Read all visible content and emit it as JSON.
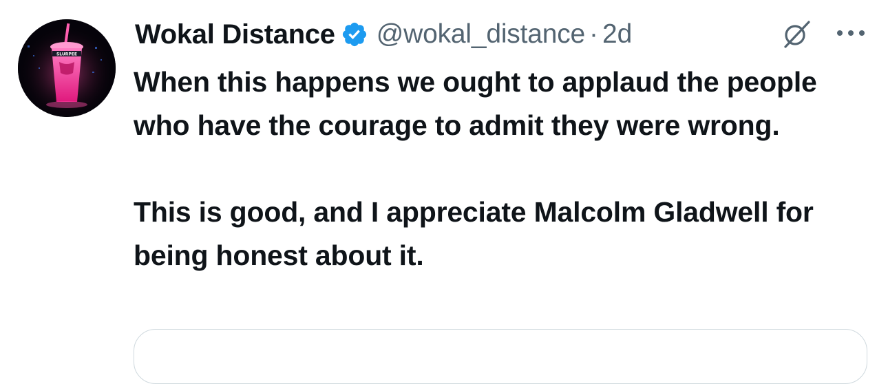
{
  "tweet": {
    "author": {
      "display_name": "Wokal Distance",
      "handle": "@wokal_distance",
      "verified": true,
      "avatar_icon": "neon-slushie-cup-icon"
    },
    "separator": "·",
    "timestamp": "2d",
    "actions": {
      "grok_icon": "grok-slash-icon",
      "more_icon": "more-dots-icon"
    },
    "text": [
      "When this happens we ought to applaud the people who have the courage to admit they were wrong.",
      "This is good, and I appreciate Malcolm Gladwell for being honest about it."
    ]
  },
  "colors": {
    "verified_blue": "#1d9bf0",
    "secondary_text": "#536471",
    "primary_text": "#0f1419",
    "card_border": "#cfd9de"
  }
}
